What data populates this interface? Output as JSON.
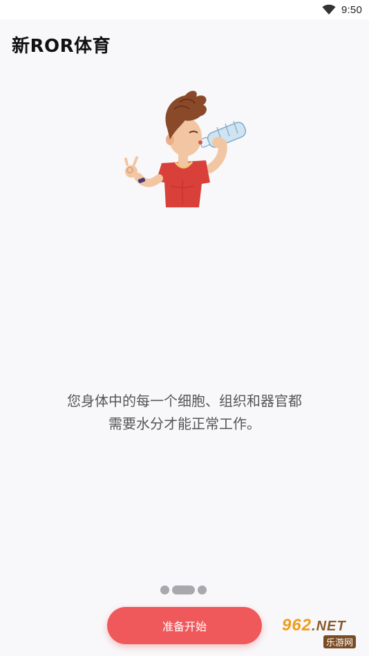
{
  "status_bar": {
    "time": "9:50",
    "icons": [
      "wifi-icon"
    ]
  },
  "header": {
    "title": "新ROR体育"
  },
  "illustration": {
    "subject": "boy-drinking-water-illustration"
  },
  "content": {
    "lines": [
      "您身体中的每一个细胞、组织和器官都",
      "需要水分才能正常工作。"
    ]
  },
  "pager": {
    "page_count": 3,
    "active_index": 1
  },
  "actions": {
    "start_label": "准备开始"
  },
  "watermark": {
    "logo_text": "962",
    "logo_suffix": ".NET",
    "subtitle": "乐游网"
  },
  "colors": {
    "accent": "#f0595c",
    "background": "#f8f8fa",
    "dot": "#a9a9ad",
    "shirt": "#d9403a",
    "hair": "#8a4a2a",
    "watermark_orange": "#f39b1a"
  }
}
